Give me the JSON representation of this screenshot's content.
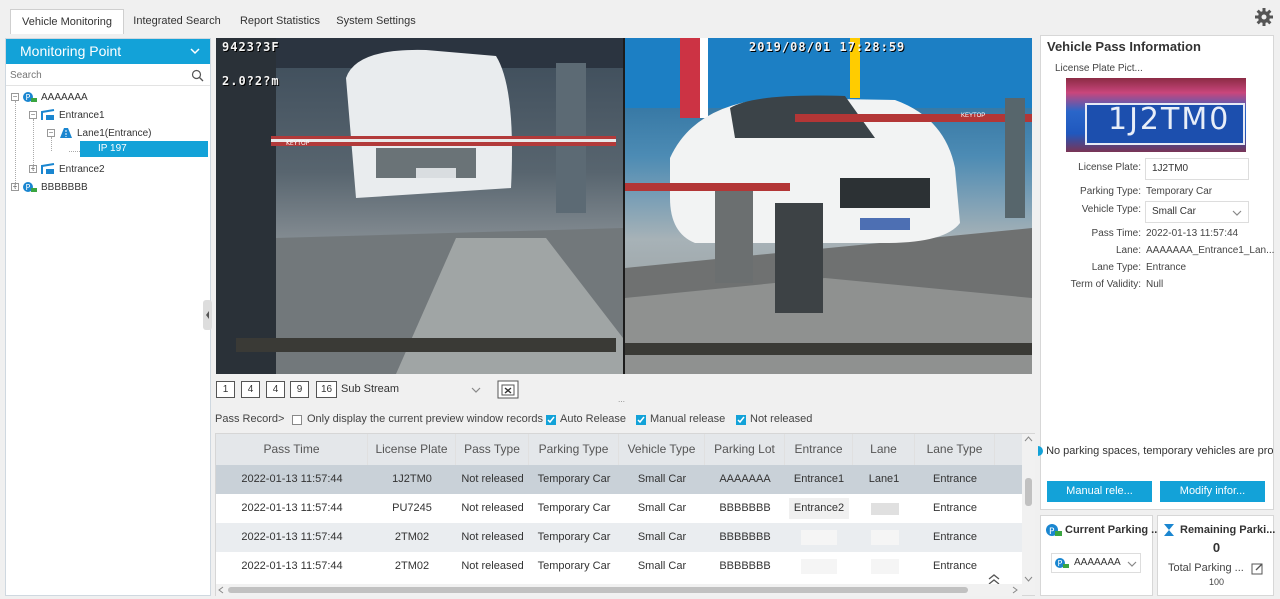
{
  "tabs": [
    "Vehicle Monitoring",
    "Integrated Search",
    "Report Statistics",
    "System Settings"
  ],
  "monitoring": {
    "title": "Monitoring Point",
    "search_placeholder": "Search",
    "tree": {
      "root1": "AAAAAAA",
      "entrance1": "Entrance1",
      "lane1": "Lane1(Entrance)",
      "ip": "IP 197",
      "entrance2": "Entrance2",
      "root2": "BBBBBBB"
    }
  },
  "video": {
    "cam1_osd_top": "9423?3F",
    "cam1_osd_side": "2.0?2?m",
    "cam2_osd": "2019/08/01 17:28:59",
    "cam2_pole_text": "KEYTOP",
    "splits": [
      "1",
      "4",
      "9",
      "16"
    ],
    "stream": "Sub Stream"
  },
  "filters": {
    "label": "Pass Record>",
    "only_current": "Only display the current preview window records",
    "auto_release": "Auto Release",
    "manual_release": "Manual release",
    "not_released": "Not released"
  },
  "table": {
    "headers": [
      "Pass Time",
      "License Plate",
      "Pass Type",
      "Parking Type",
      "Vehicle Type",
      "Parking Lot",
      "Entrance",
      "Lane",
      "Lane Type"
    ],
    "rows": [
      [
        "2022-01-13 11:57:44",
        "1J2TM0",
        "Not released",
        "Temporary Car",
        "Small Car",
        "AAAAAAA",
        "Entrance1",
        "Lane1",
        "Entrance"
      ],
      [
        "2022-01-13 11:57:44",
        "PU7245",
        "Not released",
        "Temporary Car",
        "Small Car",
        "BBBBBBB",
        "Entrance2",
        "",
        "Entrance"
      ],
      [
        "2022-01-13 11:57:44",
        "2TM02",
        "Not released",
        "Temporary Car",
        "Small Car",
        "BBBBBBB",
        "",
        "",
        "Entrance"
      ],
      [
        "2022-01-13 11:57:44",
        "2TM02",
        "Not released",
        "Temporary Car",
        "Small Car",
        "BBBBBBB",
        "",
        "",
        "Entrance"
      ]
    ]
  },
  "vehicle_info": {
    "title": "Vehicle Pass Information",
    "plate_picture_label": "License Plate Pict...",
    "plate_picture_text": "1J2TM0",
    "license_plate_label": "License Plate:",
    "license_plate": "1J2TM0",
    "parking_type_label": "Parking Type:",
    "parking_type": "Temporary Car",
    "vehicle_type_label": "Vehicle Type:",
    "vehicle_type": "Small Car",
    "pass_time_label": "Pass Time:",
    "pass_time": "2022-01-13 11:57:44",
    "lane_label": "Lane:",
    "lane": "AAAAAAA_Entrance1_Lan...",
    "lane_type_label": "Lane Type:",
    "lane_type": "Entrance",
    "validity_label": "Term of Validity:",
    "validity": "Null",
    "ticker": "No parking spaces, temporary vehicles are prohibited",
    "manual_release_btn": "Manual rele...",
    "modify_info_btn": "Modify infor..."
  },
  "current_parking": {
    "title": "Current Parking ...",
    "selected": "AAAAAAA"
  },
  "remaining": {
    "title": "Remaining Parki...",
    "count": "0",
    "total_label": "Total Parking ...",
    "total": "100"
  },
  "colors": {
    "accent": "#13a2d8"
  }
}
